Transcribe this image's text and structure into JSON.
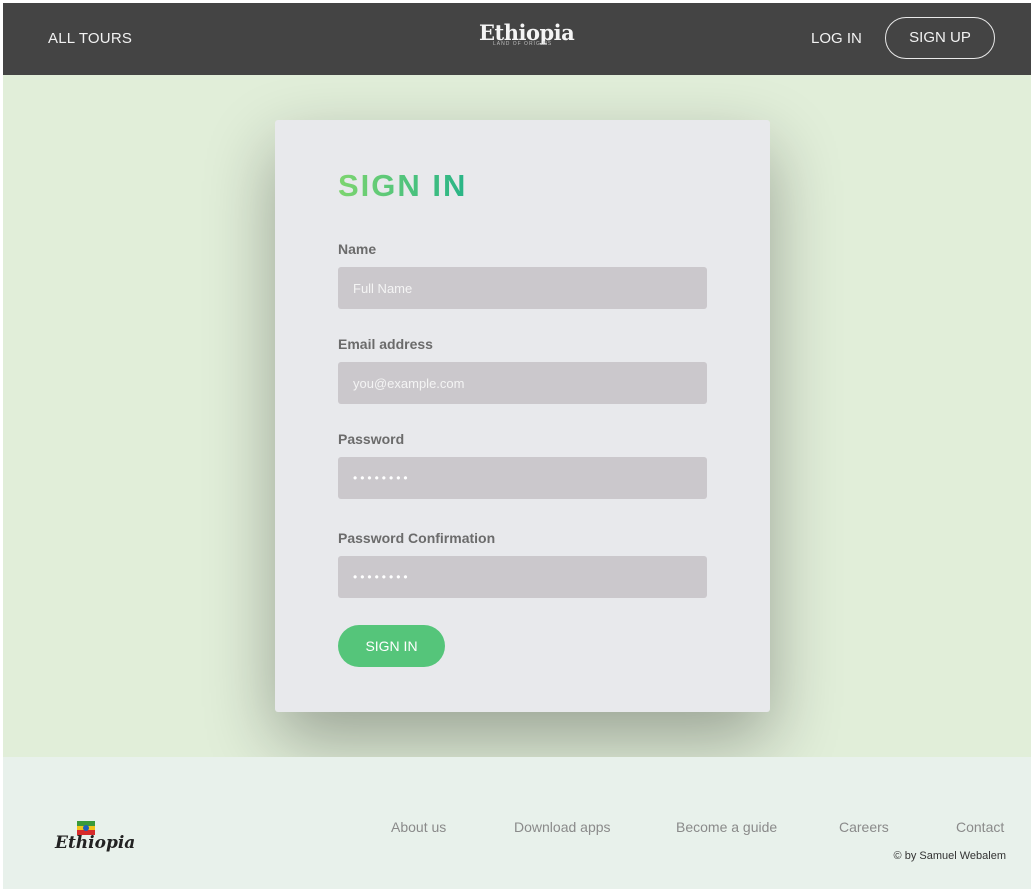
{
  "header": {
    "nav_all_tours": "ALL TOURS",
    "logo_text": "Ethiopia",
    "logo_tagline": "LAND OF ORIGINS",
    "nav_login": "LOG IN",
    "nav_signup": "SIGN UP"
  },
  "form": {
    "title": "SIGN IN",
    "name_label": "Name",
    "name_placeholder": "Full Name",
    "email_label": "Email address",
    "email_placeholder": "you@example.com",
    "password_label": "Password",
    "password_value": "••••••••",
    "confirm_label": "Password Confirmation",
    "confirm_value": "••••••••",
    "submit_label": "SIGN IN"
  },
  "footer": {
    "logo_text": "Ethiopia",
    "links": [
      "About us",
      "Download apps",
      "Become a guide",
      "Careers",
      "Contact"
    ],
    "copyright": "© by Samuel Webalem"
  },
  "colors": {
    "accent_green": "#55c57a",
    "header_bg": "#444444",
    "page_bg": "#e1eed9",
    "input_bg": "#cbc8cc"
  }
}
